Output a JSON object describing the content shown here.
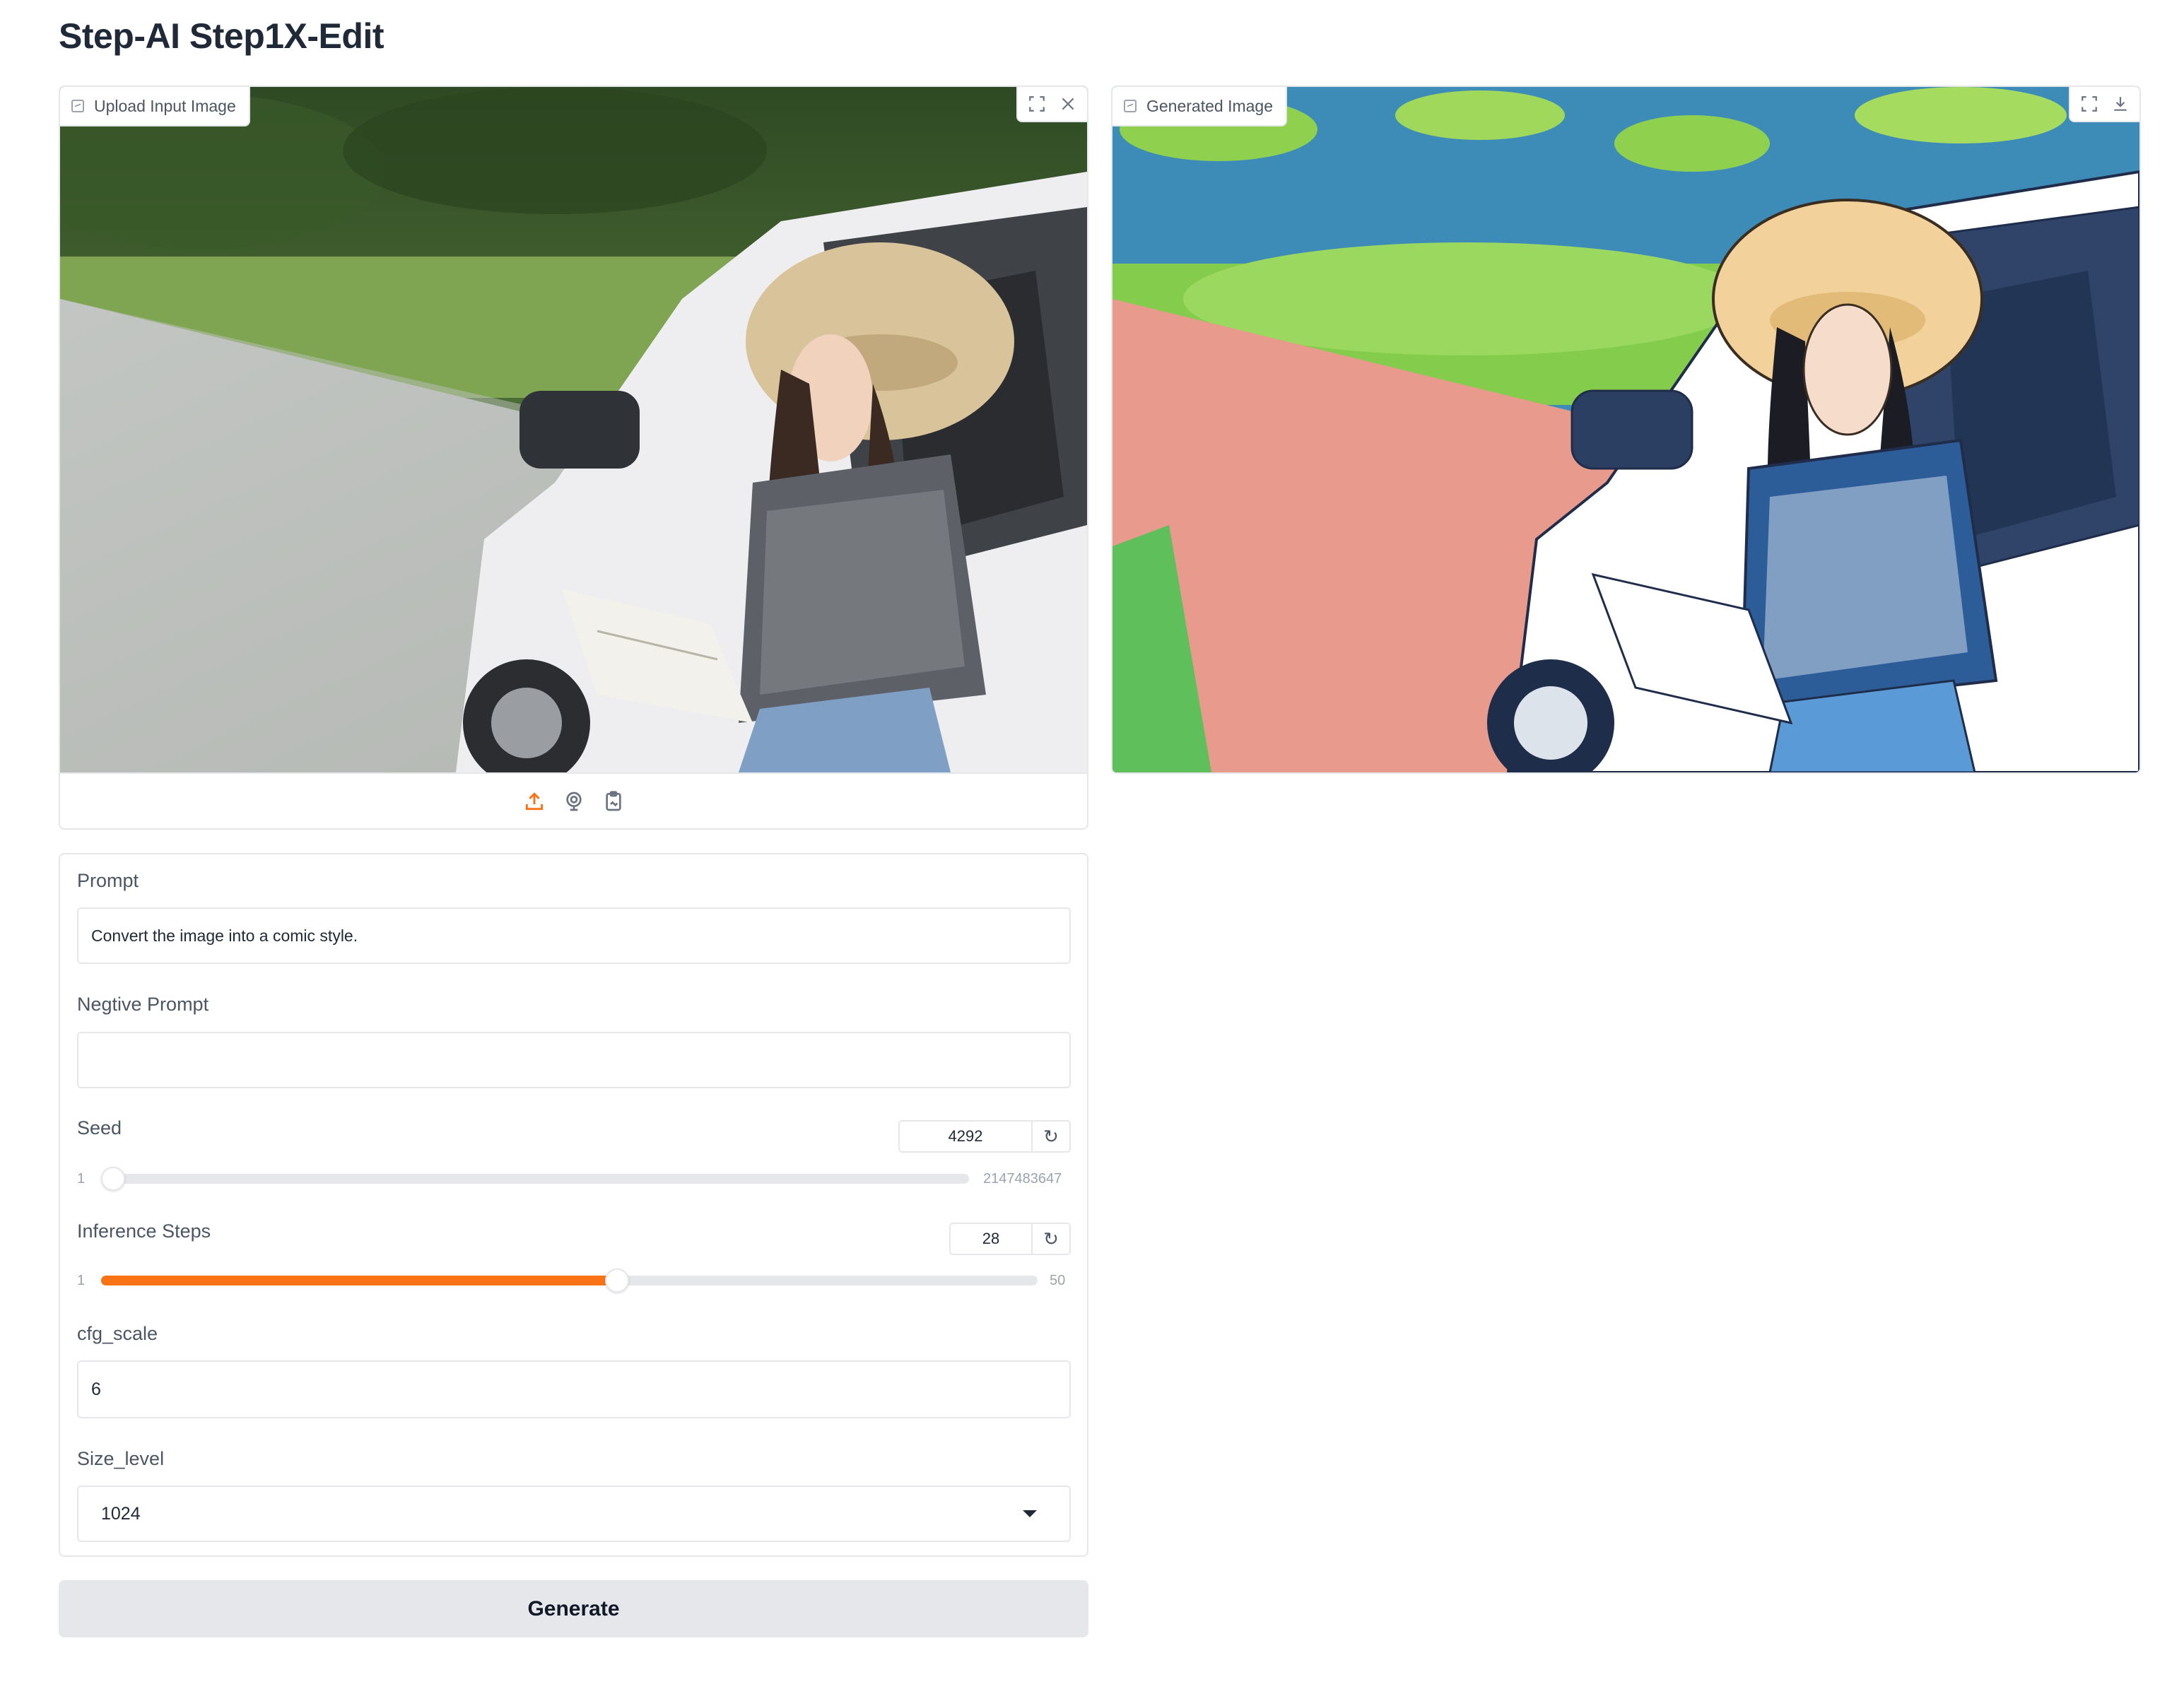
{
  "app": {
    "title": "Step-AI Step1X-Edit"
  },
  "input_image": {
    "label": "Upload Input Image",
    "tools": {
      "fullscreen_icon": "fullscreen-icon",
      "clear_icon": "close-icon"
    },
    "sources": [
      "upload-icon",
      "webcam-icon",
      "clipboard-icon"
    ]
  },
  "output_image": {
    "label": "Generated Image",
    "tools": {
      "fullscreen_icon": "fullscreen-icon",
      "download_icon": "download-icon"
    }
  },
  "form": {
    "prompt": {
      "label": "Prompt",
      "value": "Convert the image into a comic style."
    },
    "negative_prompt": {
      "label": "Negtive Prompt",
      "value": ""
    },
    "seed": {
      "label": "Seed",
      "value": "4292",
      "min": "1",
      "max": "2147483647",
      "fraction": 2e-06
    },
    "steps": {
      "label": "Inference Steps",
      "value": "28",
      "min": "1",
      "max": "50",
      "fraction": 0.551
    },
    "cfg_scale": {
      "label": "cfg_scale",
      "value": "6"
    },
    "size_level": {
      "label": "Size_level",
      "value": "1024"
    }
  },
  "generate": {
    "label": "Generate"
  },
  "colors": {
    "accent": "#f97316",
    "border": "#e5e7eb",
    "button_bg": "#e5e7eb"
  }
}
